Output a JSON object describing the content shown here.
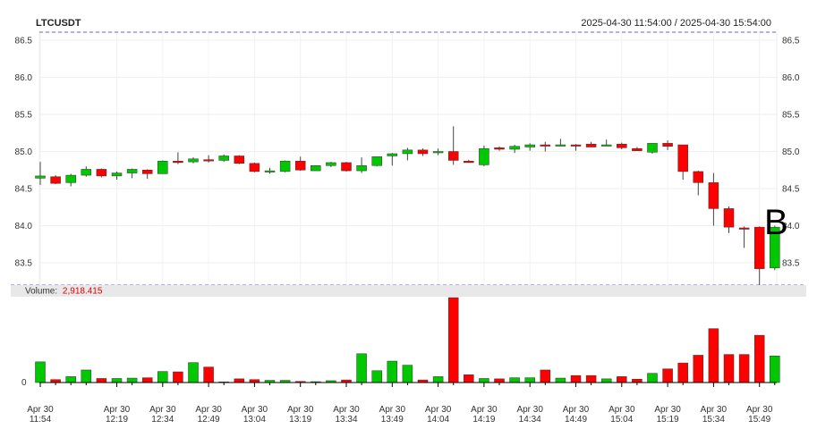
{
  "header": {
    "symbol": "LTCUSDT",
    "range": "2025-04-30 11:54:00 / 2025-04-30 15:54:00"
  },
  "volume_label": "Volume:",
  "volume_value": "2,918.415",
  "marker_letter": "B",
  "colors": {
    "up": "#00c800",
    "down": "#ff0000",
    "volume_text": "#e00000",
    "dashed": "#6666cc",
    "grid": "#eeeeee"
  },
  "chart_data": {
    "type": "candlestick",
    "price_ylim": [
      83.2,
      86.6
    ],
    "price_ticks": [
      "86.5",
      "86.0",
      "85.5",
      "85.0",
      "84.5",
      "84.0",
      "83.5"
    ],
    "x_ticks": [
      {
        "index": 0,
        "date": "Apr 30",
        "time": "11:54"
      },
      {
        "index": 5,
        "date": "Apr 30",
        "time": "12:19"
      },
      {
        "index": 8,
        "date": "Apr 30",
        "time": "12:34"
      },
      {
        "index": 11,
        "date": "Apr 30",
        "time": "12:49"
      },
      {
        "index": 14,
        "date": "Apr 30",
        "time": "13:04"
      },
      {
        "index": 17,
        "date": "Apr 30",
        "time": "13:19"
      },
      {
        "index": 20,
        "date": "Apr 30",
        "time": "13:34"
      },
      {
        "index": 23,
        "date": "Apr 30",
        "time": "13:49"
      },
      {
        "index": 26,
        "date": "Apr 30",
        "time": "14:04"
      },
      {
        "index": 29,
        "date": "Apr 30",
        "time": "14:19"
      },
      {
        "index": 32,
        "date": "Apr 30",
        "time": "14:34"
      },
      {
        "index": 35,
        "date": "Apr 30",
        "time": "14:49"
      },
      {
        "index": 38,
        "date": "Apr 30",
        "time": "15:04"
      },
      {
        "index": 41,
        "date": "Apr 30",
        "time": "15:19"
      },
      {
        "index": 44,
        "date": "Apr 30",
        "time": "15:34"
      },
      {
        "index": 47,
        "date": "Apr 30",
        "time": "15:49"
      }
    ],
    "candles": [
      {
        "o": 84.64,
        "h": 84.86,
        "l": 84.55,
        "c": 84.67,
        "v": 280
      },
      {
        "o": 84.66,
        "h": 84.68,
        "l": 84.56,
        "c": 84.57,
        "v": 40
      },
      {
        "o": 84.58,
        "h": 84.7,
        "l": 84.53,
        "c": 84.68,
        "v": 80
      },
      {
        "o": 84.68,
        "h": 84.8,
        "l": 84.66,
        "c": 84.76,
        "v": 170
      },
      {
        "o": 84.76,
        "h": 84.77,
        "l": 84.65,
        "c": 84.67,
        "v": 55
      },
      {
        "o": 84.67,
        "h": 84.73,
        "l": 84.62,
        "c": 84.71,
        "v": 55
      },
      {
        "o": 84.71,
        "h": 84.77,
        "l": 84.64,
        "c": 84.76,
        "v": 60
      },
      {
        "o": 84.75,
        "h": 84.76,
        "l": 84.63,
        "c": 84.7,
        "v": 65
      },
      {
        "o": 84.7,
        "h": 84.88,
        "l": 84.7,
        "c": 84.87,
        "v": 150
      },
      {
        "o": 84.87,
        "h": 84.99,
        "l": 84.83,
        "c": 84.85,
        "v": 145
      },
      {
        "o": 84.86,
        "h": 84.92,
        "l": 84.84,
        "c": 84.9,
        "v": 270
      },
      {
        "o": 84.89,
        "h": 84.95,
        "l": 84.85,
        "c": 84.88,
        "v": 210
      },
      {
        "o": 84.88,
        "h": 84.96,
        "l": 84.86,
        "c": 84.94,
        "v": 8
      },
      {
        "o": 84.94,
        "h": 84.95,
        "l": 84.83,
        "c": 84.84,
        "v": 50
      },
      {
        "o": 84.84,
        "h": 84.85,
        "l": 84.72,
        "c": 84.73,
        "v": 40
      },
      {
        "o": 84.73,
        "h": 84.78,
        "l": 84.7,
        "c": 84.74,
        "v": 30
      },
      {
        "o": 84.73,
        "h": 84.88,
        "l": 84.72,
        "c": 84.87,
        "v": 30
      },
      {
        "o": 84.87,
        "h": 84.93,
        "l": 84.74,
        "c": 84.75,
        "v": 15
      },
      {
        "o": 84.74,
        "h": 84.81,
        "l": 84.74,
        "c": 84.81,
        "v": 12
      },
      {
        "o": 84.81,
        "h": 84.86,
        "l": 84.79,
        "c": 84.85,
        "v": 25
      },
      {
        "o": 84.85,
        "h": 84.86,
        "l": 84.73,
        "c": 84.74,
        "v": 35
      },
      {
        "o": 84.74,
        "h": 84.92,
        "l": 84.71,
        "c": 84.81,
        "v": 390
      },
      {
        "o": 84.81,
        "h": 84.93,
        "l": 84.8,
        "c": 84.93,
        "v": 160
      },
      {
        "o": 84.94,
        "h": 84.98,
        "l": 84.81,
        "c": 84.97,
        "v": 290
      },
      {
        "o": 84.97,
        "h": 85.05,
        "l": 84.88,
        "c": 85.02,
        "v": 235
      },
      {
        "o": 85.02,
        "h": 85.04,
        "l": 84.94,
        "c": 84.97,
        "v": 35
      },
      {
        "o": 84.99,
        "h": 85.04,
        "l": 84.95,
        "c": 85.0,
        "v": 80
      },
      {
        "o": 85.0,
        "h": 85.34,
        "l": 84.82,
        "c": 84.88,
        "v": 1150
      },
      {
        "o": 84.87,
        "h": 84.89,
        "l": 84.85,
        "c": 84.85,
        "v": 105
      },
      {
        "o": 84.82,
        "h": 85.08,
        "l": 84.8,
        "c": 85.04,
        "v": 55
      },
      {
        "o": 85.05,
        "h": 85.07,
        "l": 85.01,
        "c": 85.03,
        "v": 50
      },
      {
        "o": 85.03,
        "h": 85.09,
        "l": 84.98,
        "c": 85.07,
        "v": 65
      },
      {
        "o": 85.06,
        "h": 85.11,
        "l": 85.01,
        "c": 85.09,
        "v": 65
      },
      {
        "o": 85.09,
        "h": 85.13,
        "l": 85.0,
        "c": 85.08,
        "v": 170
      },
      {
        "o": 85.08,
        "h": 85.17,
        "l": 85.07,
        "c": 85.09,
        "v": 60
      },
      {
        "o": 85.09,
        "h": 85.1,
        "l": 85.01,
        "c": 85.08,
        "v": 95
      },
      {
        "o": 85.1,
        "h": 85.13,
        "l": 85.06,
        "c": 85.06,
        "v": 95
      },
      {
        "o": 85.08,
        "h": 85.16,
        "l": 85.07,
        "c": 85.09,
        "v": 50
      },
      {
        "o": 85.1,
        "h": 85.12,
        "l": 85.03,
        "c": 85.05,
        "v": 80
      },
      {
        "o": 85.04,
        "h": 85.06,
        "l": 85.01,
        "c": 85.01,
        "v": 45
      },
      {
        "o": 84.99,
        "h": 85.11,
        "l": 84.97,
        "c": 85.11,
        "v": 125
      },
      {
        "o": 85.11,
        "h": 85.15,
        "l": 85.02,
        "c": 85.07,
        "v": 185
      },
      {
        "o": 85.09,
        "h": 85.09,
        "l": 84.62,
        "c": 84.73,
        "v": 265
      },
      {
        "o": 84.73,
        "h": 84.74,
        "l": 84.41,
        "c": 84.58,
        "v": 370
      },
      {
        "o": 84.58,
        "h": 84.71,
        "l": 84.0,
        "c": 84.23,
        "v": 730
      },
      {
        "o": 84.23,
        "h": 84.26,
        "l": 83.9,
        "c": 83.98,
        "v": 380
      },
      {
        "o": 83.97,
        "h": 83.99,
        "l": 83.7,
        "c": 83.96,
        "v": 380
      },
      {
        "o": 83.98,
        "h": 83.99,
        "l": 83.19,
        "c": 83.42,
        "v": 640
      },
      {
        "o": 83.43,
        "h": 84.0,
        "l": 83.4,
        "c": 83.98,
        "v": 360
      }
    ]
  }
}
